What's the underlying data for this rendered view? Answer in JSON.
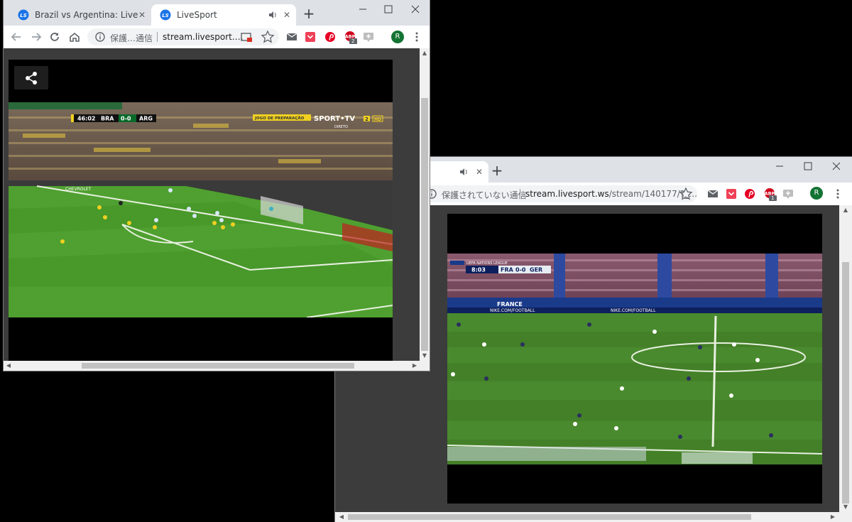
{
  "win1": {
    "tabs": [
      {
        "title": "Brazil vs Argentina: Live St",
        "active": false
      },
      {
        "title": "LiveSport",
        "active": true
      }
    ],
    "omnibox": {
      "security": "保護…通信",
      "url": "stream.livesport.…"
    },
    "ext_badge": "2",
    "avatar_letter": "R",
    "video": {
      "clock": "46:02",
      "home": "BRA",
      "score": "0-0",
      "away": "ARG",
      "tag": "JOGO DE PREPARAÇÃO",
      "network": "SPORT•TV",
      "channel": "2",
      "hd": "HD",
      "sub": "DIRETO",
      "board_text": "CHEVROLET"
    }
  },
  "win2": {
    "omnibox": {
      "security": "保護されていない通信",
      "url_host": "stream.livesport.ws",
      "url_path": "/stream/140177/?_…"
    },
    "ext_badge": "1",
    "avatar_letter": "R",
    "video": {
      "league": "UEFA NATIONS LEAGUE",
      "clock": "8:03",
      "home": "FRA",
      "score": "0-0",
      "away": "GER",
      "board_left": "FRANCE",
      "board_mid": "NIKE.COM/FOOTBALL",
      "board_right": "NIKE.COM/FOOTBALL"
    }
  },
  "colors": {
    "pitch": "#4a8a2e",
    "tabstrip": "#dee1e6",
    "avatar": "#137333",
    "accent": "#1a73e8"
  }
}
